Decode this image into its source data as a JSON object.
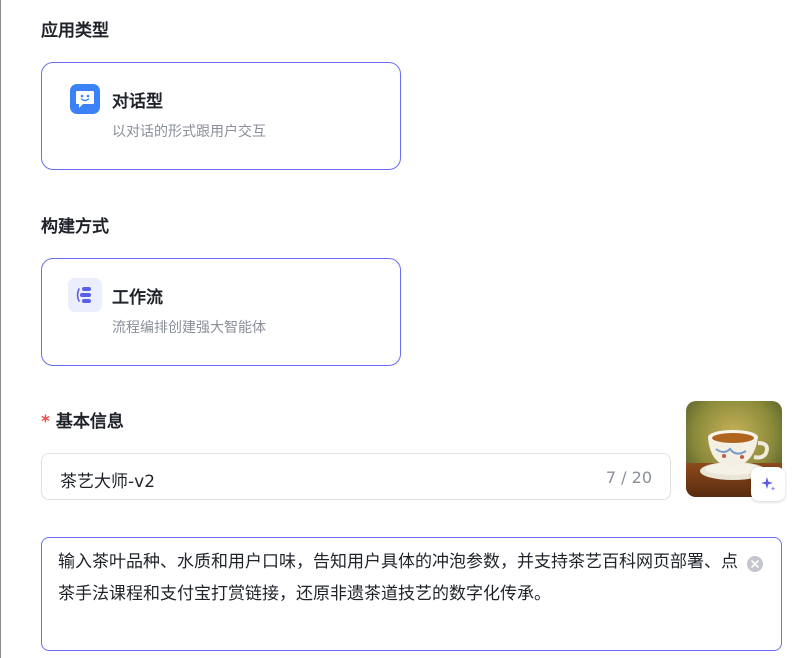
{
  "app_type": {
    "title": "应用类型",
    "card": {
      "title": "对话型",
      "description": "以对话的形式跟用户交互",
      "icon": "chat-bubble-icon",
      "icon_color": "#3370ff"
    }
  },
  "build_method": {
    "title": "构建方式",
    "card": {
      "title": "工作流",
      "description": "流程编排创建强大智能体",
      "icon": "workflow-icon",
      "icon_color": "#5b5fe8"
    }
  },
  "basic_info": {
    "required_mark": "*",
    "title": "基本信息",
    "name_value": "茶艺大师-v2",
    "name_counter": "7 / 20",
    "avatar_icon": "teacup-avatar",
    "ai_generate_icon": "sparkle-icon",
    "description_value": "输入茶叶品种、水质和用户口味，告知用户具体的冲泡参数，并支持茶艺百科网页部署、点茶手法课程和支付宝打赏链接，还原非遗茶道技艺的数字化传承。"
  },
  "colors": {
    "accent": "#6b6ef0",
    "required": "#f54a45",
    "muted_text": "#8a8f99"
  }
}
